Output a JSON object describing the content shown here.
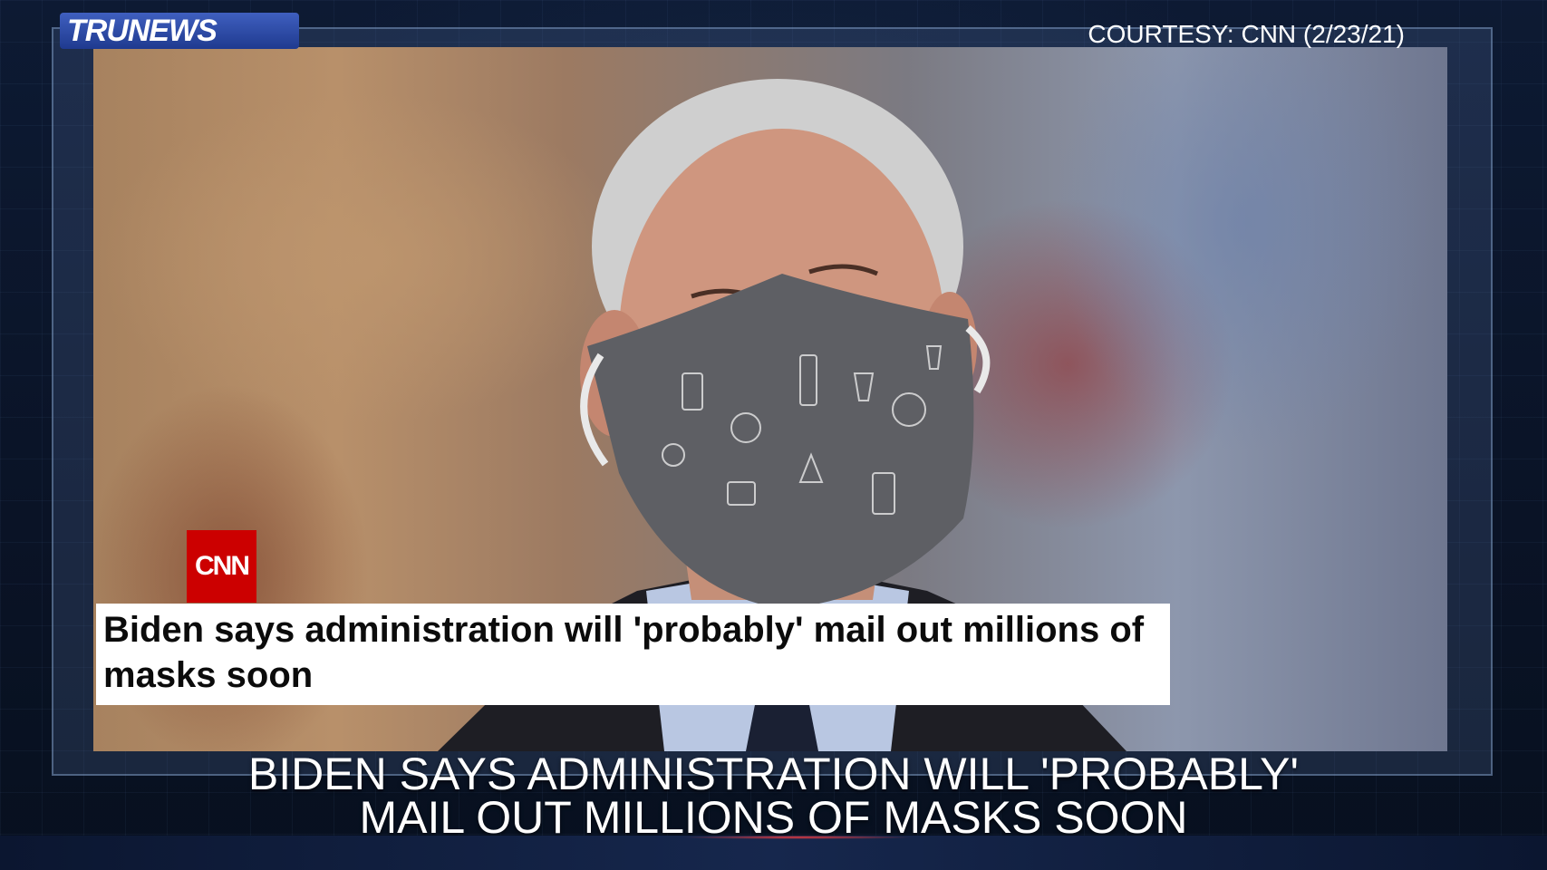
{
  "overlay": {
    "logo_text": "TRUNEWS",
    "courtesy": "COURTESY: CNN (2/23/21)"
  },
  "article": {
    "source_badge": "CNN",
    "headline": "Biden says administration will 'probably' mail out millions of masks soon"
  },
  "lower_third": {
    "line1": "BIDEN SAYS ADMINISTRATION WILL 'PROBABLY'",
    "line2": "MAIL OUT MILLIONS OF MASKS SOON"
  },
  "colors": {
    "cnn_red": "#cc0000",
    "frame_bg": "#0a1326"
  }
}
